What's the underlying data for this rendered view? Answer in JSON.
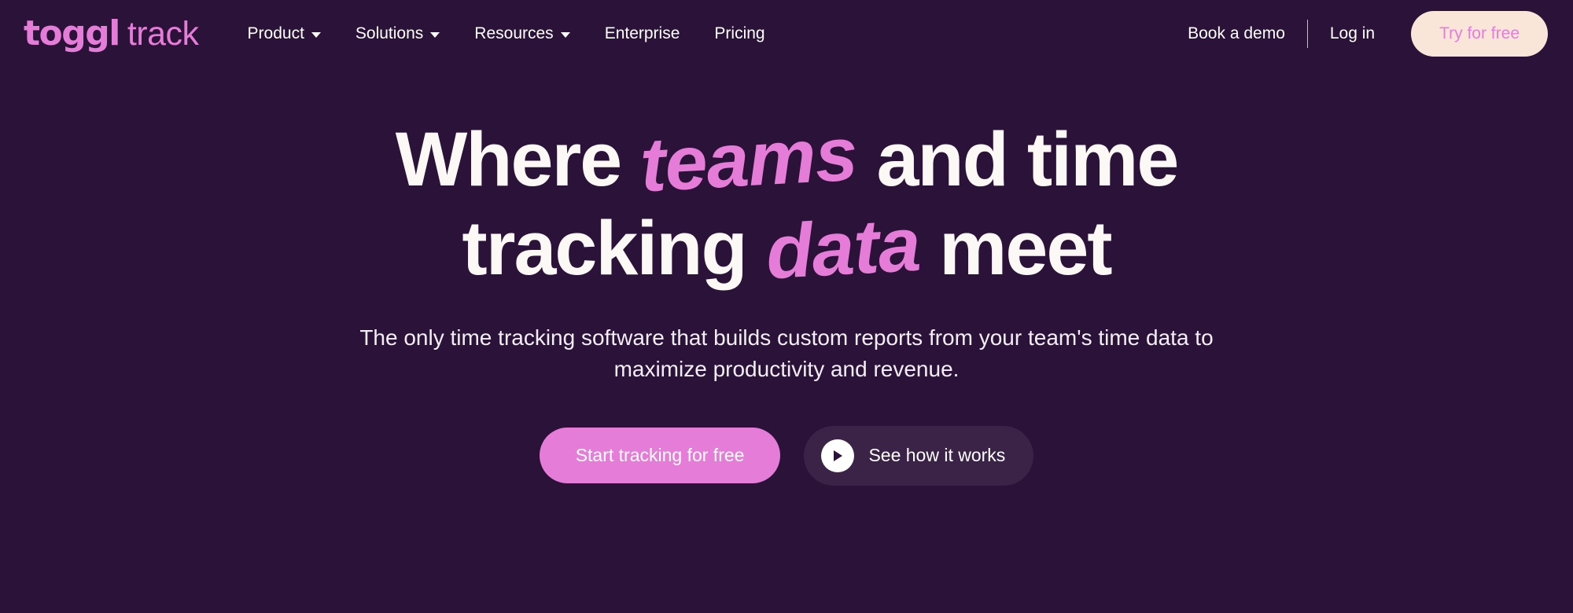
{
  "brand": {
    "name_bold": "toggl",
    "name_light": "track",
    "logo_color": "#e57cd8"
  },
  "theme": {
    "background": "#2b1238",
    "accent_pink": "#e57cd8",
    "cream": "#fae6d9",
    "secondary_button": "#3b2247",
    "text_white": "#fbf8f6"
  },
  "nav": {
    "links": [
      {
        "label": "Product",
        "has_dropdown": true,
        "icon": "chevron-down-icon"
      },
      {
        "label": "Solutions",
        "has_dropdown": true,
        "icon": "chevron-down-icon"
      },
      {
        "label": "Resources",
        "has_dropdown": true,
        "icon": "chevron-down-icon"
      },
      {
        "label": "Enterprise",
        "has_dropdown": false,
        "icon": ""
      },
      {
        "label": "Pricing",
        "has_dropdown": false,
        "icon": ""
      }
    ],
    "book_demo_label": "Book a demo",
    "login_label": "Log in",
    "try_free_label": "Try for free"
  },
  "hero": {
    "headline": {
      "line1_part1": "Where ",
      "line1_accent": "teams",
      "line1_part2": " and time",
      "line2_part1": "tracking ",
      "line2_accent": "data",
      "line2_part2": " meet"
    },
    "subhead_line1": "The only time tracking software that builds custom reports from your team's",
    "subhead_line2": "time data to maximize productivity and revenue.",
    "primary_cta": "Start tracking for free",
    "secondary_cta": "See how it works",
    "secondary_cta_icon": "play-circle-icon"
  }
}
